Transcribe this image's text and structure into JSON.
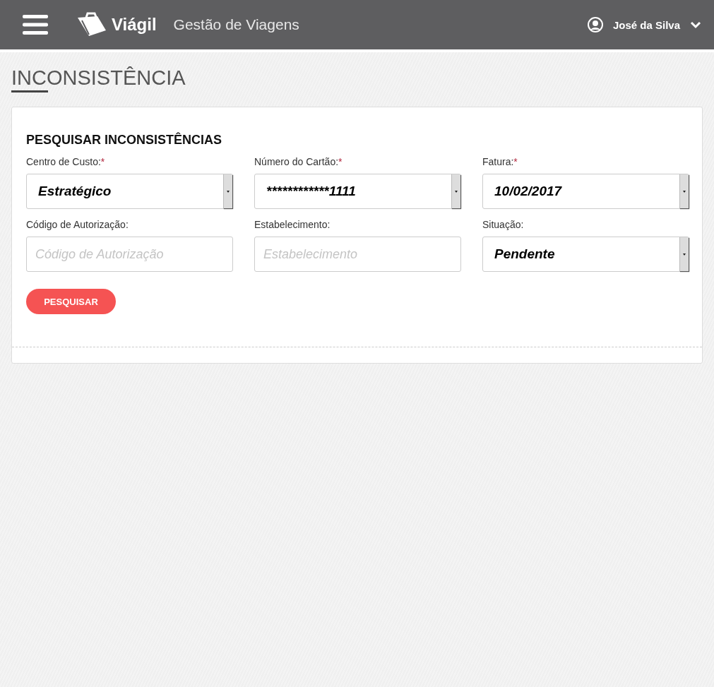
{
  "header": {
    "brand": "Viágil",
    "subtitle": "Gestão de Viagens",
    "user": "José da Silva"
  },
  "page_title": "INCONSISTÊNCIA",
  "search_panel": {
    "title": "PESQUISAR INCONSISTÊNCIAS",
    "fields": [
      {
        "kind": "select",
        "label": "Centro de Custo:",
        "asterisk": "*",
        "value": "Estratégico"
      },
      {
        "kind": "select",
        "label": "Número do Cartão:",
        "asterisk": "*",
        "value": "************1111"
      },
      {
        "kind": "select",
        "label": "Fatura:",
        "asterisk": "*",
        "value": "10/02/2017"
      },
      {
        "kind": "input",
        "label": "Código de Autorização:",
        "placeholder": "Código de Autorização"
      },
      {
        "kind": "input",
        "label": "Estabelecimento:",
        "placeholder": "Estabelecimento"
      },
      {
        "kind": "select",
        "label": "Situação:",
        "value": "Pendente"
      }
    ],
    "button": "PESQUISAR"
  }
}
